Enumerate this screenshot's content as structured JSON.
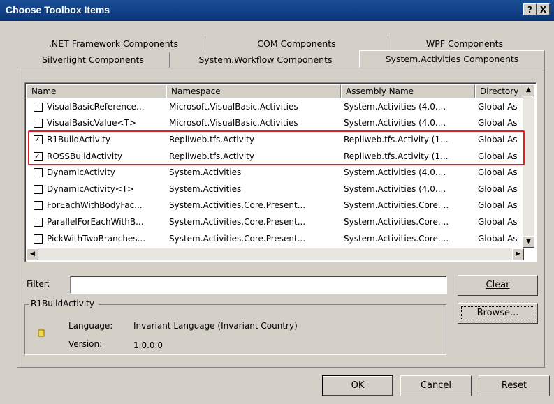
{
  "window": {
    "title": "Choose Toolbox Items",
    "help_label": "?",
    "close_label": "X"
  },
  "tabs_row1": [
    ".NET Framework Components",
    "COM Components",
    "WPF Components"
  ],
  "tabs_row2": [
    "Silverlight Components",
    "System.Workflow Components",
    "System.Activities Components"
  ],
  "columns": [
    "Name",
    "Namespace",
    "Assembly Name",
    "Directory"
  ],
  "rows": [
    {
      "checked": false,
      "name": "VisualBasicReference...",
      "namespace": "Microsoft.VisualBasic.Activities",
      "assembly": "System.Activities (4.0....",
      "directory": "Global As"
    },
    {
      "checked": false,
      "name": "VisualBasicValue<T>",
      "namespace": "Microsoft.VisualBasic.Activities",
      "assembly": "System.Activities (4.0....",
      "directory": "Global As"
    },
    {
      "checked": true,
      "name": "R1BuildActivity",
      "namespace": "Repliweb.tfs.Activity",
      "assembly": "Repliweb.tfs.Activity (1...",
      "directory": "Global As"
    },
    {
      "checked": true,
      "name": "ROSSBuildActivity",
      "namespace": "Repliweb.tfs.Activity",
      "assembly": "Repliweb.tfs.Activity (1...",
      "directory": "Global As"
    },
    {
      "checked": false,
      "name": "DynamicActivity",
      "namespace": "System.Activities",
      "assembly": "System.Activities (4.0....",
      "directory": "Global As"
    },
    {
      "checked": false,
      "name": "DynamicActivity<T>",
      "namespace": "System.Activities",
      "assembly": "System.Activities (4.0....",
      "directory": "Global As"
    },
    {
      "checked": false,
      "name": "ForEachWithBodyFac...",
      "namespace": "System.Activities.Core.Present...",
      "assembly": "System.Activities.Core....",
      "directory": "Global As"
    },
    {
      "checked": false,
      "name": "ParallelForEachWithB...",
      "namespace": "System.Activities.Core.Present...",
      "assembly": "System.Activities.Core....",
      "directory": "Global As"
    },
    {
      "checked": false,
      "name": "PickWithTwoBranches...",
      "namespace": "System.Activities.Core.Present...",
      "assembly": "System.Activities.Core....",
      "directory": "Global As"
    }
  ],
  "filter": {
    "label": "Filter:",
    "value": ""
  },
  "details": {
    "title": "R1BuildActivity",
    "language_label": "Language:",
    "language_value": "Invariant Language (Invariant Country)",
    "version_label": "Version:",
    "version_value": "1.0.0.0"
  },
  "buttons": {
    "clear": "Clear",
    "browse": "Browse...",
    "ok": "OK",
    "cancel": "Cancel",
    "reset": "Reset"
  },
  "icons": {
    "scroll_up": "▲",
    "scroll_down": "▼",
    "scroll_left": "◀",
    "scroll_right": "▶"
  }
}
